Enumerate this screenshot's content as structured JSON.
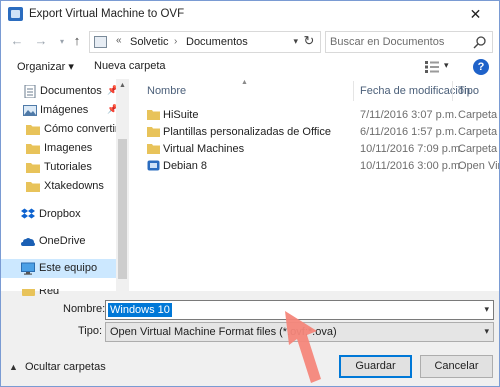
{
  "window": {
    "title": "Export Virtual Machine to OVF",
    "close_glyph": "✕"
  },
  "nav": {
    "back_glyph": "←",
    "forward_glyph": "→",
    "up_glyph": "↑",
    "crumb_prefix": "«",
    "breadcrumbs": [
      "Solvetic",
      "Documentos"
    ],
    "crumb_separator": "›",
    "refresh_glyph": "↻",
    "search_placeholder": "Buscar en Documentos"
  },
  "toolbar": {
    "organize_label": "Organizar ▾",
    "new_folder_label": "Nueva carpeta",
    "view_dd": "▾",
    "help_label": "?"
  },
  "sidebar": {
    "items": [
      {
        "label": "Documentos",
        "icon": "documents-icon",
        "pinned": true
      },
      {
        "label": "Imágenes",
        "icon": "pictures-icon",
        "pinned": true
      },
      {
        "label": "Cómo convertir",
        "icon": "folder-icon",
        "pinned": false
      },
      {
        "label": "Imagenes",
        "icon": "folder-icon",
        "pinned": false
      },
      {
        "label": "Tutoriales",
        "icon": "folder-icon",
        "pinned": false
      },
      {
        "label": "Xtakedowns",
        "icon": "folder-icon",
        "pinned": false
      },
      {
        "label": "Dropbox",
        "icon": "dropbox-icon",
        "pinned": false
      },
      {
        "label": "OneDrive",
        "icon": "onedrive-icon",
        "pinned": false
      },
      {
        "label": "Este equipo",
        "icon": "this-pc-icon",
        "pinned": false,
        "selected": true
      }
    ],
    "partial_item_label": "Red",
    "pin_glyph": "📌"
  },
  "columns": {
    "name": "Nombre",
    "date": "Fecha de modificación",
    "type": "Tipo"
  },
  "files": [
    {
      "name": "HiSuite",
      "date": "7/11/2016 3:07 p.m.",
      "type": "Carpeta de",
      "icon": "folder-icon"
    },
    {
      "name": "Plantillas personalizadas de Office",
      "date": "6/11/2016 1:57 p.m.",
      "type": "Carpeta de",
      "icon": "folder-icon"
    },
    {
      "name": "Virtual Machines",
      "date": "10/11/2016 7:09 p.m.",
      "type": "Carpeta de",
      "icon": "folder-icon"
    },
    {
      "name": "Debian 8",
      "date": "10/11/2016 3:00 p.m.",
      "type": "Open Virtu",
      "icon": "vm-icon"
    }
  ],
  "form": {
    "name_label": "Nombre:",
    "name_value": "Windows 10",
    "type_label": "Tipo:",
    "type_value": "Open Virtual Machine Format files (*.ovf;*.ova)",
    "dd_glyph": "▾"
  },
  "footer": {
    "hide_folders_label": "Ocultar carpetas",
    "chevron": "▲",
    "save_label": "Guardar",
    "cancel_label": "Cancelar"
  },
  "colors": {
    "accent": "#0078d7",
    "selected_bg": "#cce8ff",
    "folder": "#e8c35a",
    "annotation_arrow": "#f4867a"
  }
}
